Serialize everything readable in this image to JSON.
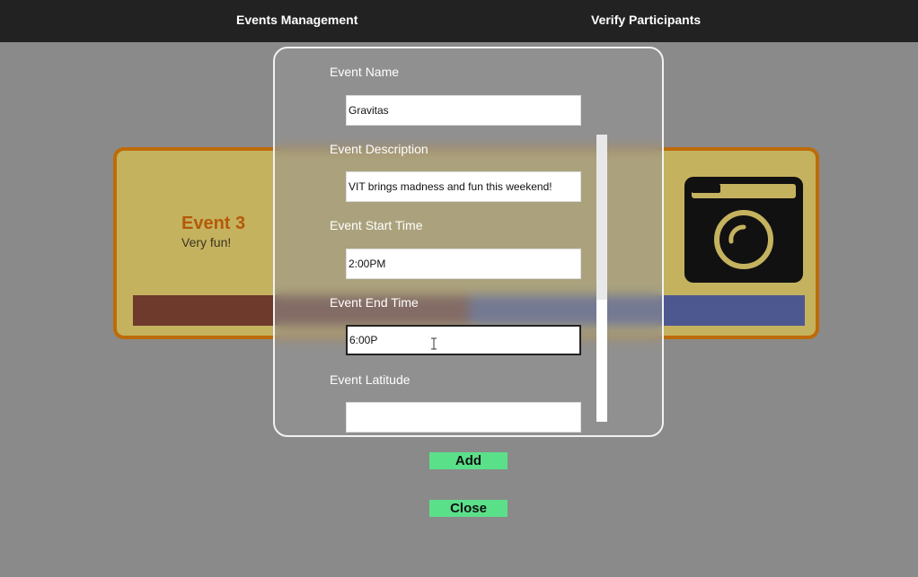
{
  "nav": {
    "events_label": "Events Management",
    "verify_label": "Verify Participants"
  },
  "event_card": {
    "title": "Event 3",
    "description": "Very fun!",
    "camera_icon": "camera-icon"
  },
  "modal": {
    "fields": [
      {
        "label": "Event Name",
        "value": "Gravitas"
      },
      {
        "label": "Event Description",
        "value": "VIT brings madness and fun this weekend!"
      },
      {
        "label": "Event Start Time",
        "value": "2:00PM"
      },
      {
        "label": "Event End Time",
        "value": "6:00P"
      },
      {
        "label": "Event Latitude",
        "value": ""
      }
    ]
  },
  "actions": {
    "add_label": "Add",
    "close_label": "Close"
  },
  "colors": {
    "card_border": "#bd6b08",
    "card_bg": "#c5b25f",
    "button_green": "#5be08a",
    "topbar": "#222222"
  }
}
